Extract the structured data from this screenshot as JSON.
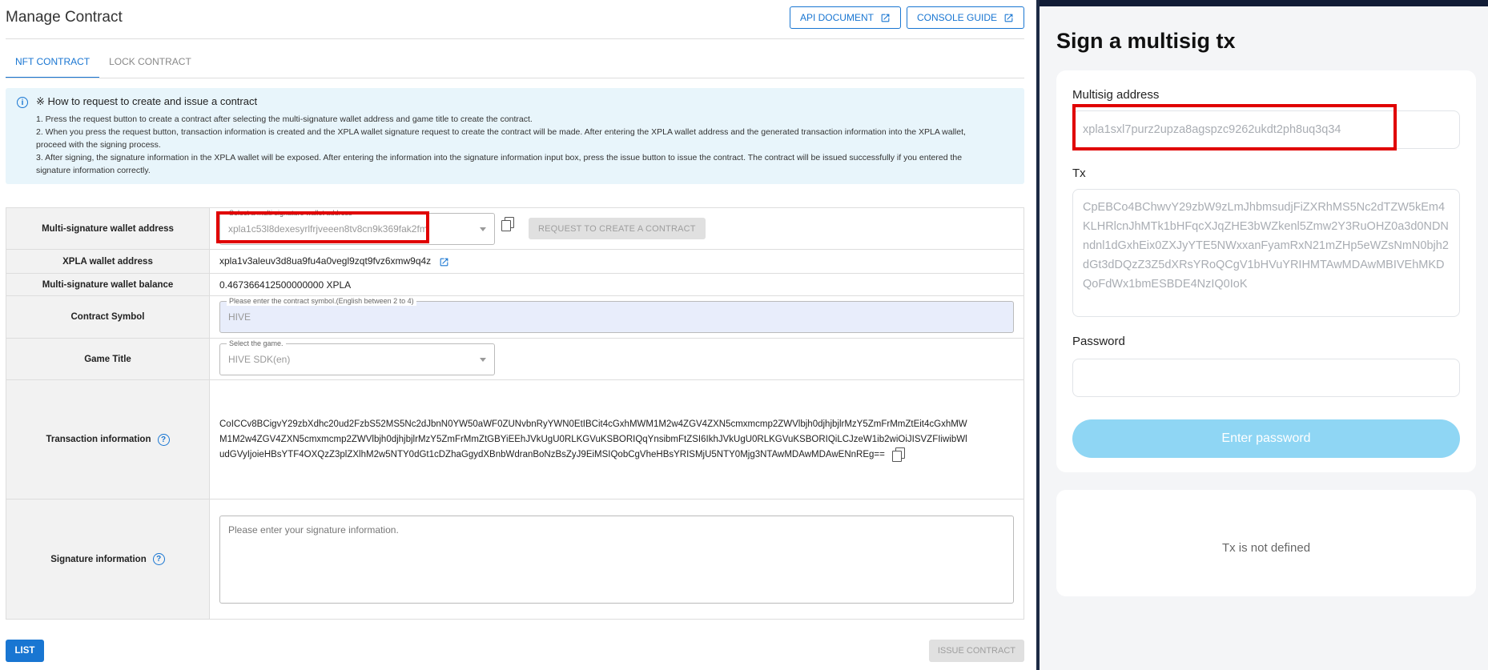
{
  "left": {
    "title": "Manage Contract",
    "buttons": {
      "api_document": "API DOCUMENT",
      "console_guide": "CONSOLE GUIDE"
    },
    "tabs": [
      {
        "label": "NFT CONTRACT",
        "active": true
      },
      {
        "label": "LOCK CONTRACT",
        "active": false
      }
    ],
    "info": {
      "title": "※ How to request to create and issue a contract",
      "lines": [
        "1. Press the request button to create a contract after selecting the multi-signature wallet address and game title to create the contract.",
        "2. When you press the request button, transaction information is created and the XPLA wallet signature request to create the contract will be made. After entering the XPLA wallet address and the generated transaction information into the XPLA wallet,",
        "proceed with the signing process.",
        "3. After signing, the signature information in the XPLA wallet will be exposed. After entering the information into the signature information input box, press the issue button to issue the contract. The contract will be issued successfully if you entered the",
        "signature information correctly."
      ]
    },
    "form": {
      "multisig_label": "Multi-signature wallet address",
      "multisig_legend": "Select a multi signature wallet address",
      "multisig_value": "xpla1c53l8dexesyrlfrjveeen8tv8cn9k369fak2fm",
      "request_button": "REQUEST TO CREATE A CONTRACT",
      "xpla_label": "XPLA wallet address",
      "xpla_value": "xpla1v3aleuv3d8ua9fu4a0vegl9zqt9fvz6xmw9q4z",
      "balance_label": "Multi-signature wallet balance",
      "balance_value": "0.467366412500000000 XPLA",
      "symbol_label": "Contract Symbol",
      "symbol_legend": "Please enter the contract symbol.(English between 2 to 4)",
      "symbol_value": "HIVE",
      "game_label": "Game Title",
      "game_legend": "Select the game.",
      "game_value": "HIVE SDK(en)",
      "tx_label": "Transaction information",
      "tx_lines": [
        "CoICCv8BCigvY29zbXdhc20ud2FzbS52MS5Nc2dJbnN0YW50aWF0ZUNvbnRyYWN0EtIBCit4cGxhMWM1M2w4ZGV4ZXN5cmxmcmp2ZWVlbjh0djhjbjlrMzY5ZmFrMmZtEit4cGxhMW",
        "M1M2w4ZGV4ZXN5cmxmcmp2ZWVlbjh0djhjbjlrMzY5ZmFrMmZtGBYiEEhJVkUgU0RLKGVuKSBORIQqYnsibmFtZSI6IkhJVkUgU0RLKGVuKSBORIQiLCJzeW1ib2wiOiJISVZFIiwibWl",
        "udGVyIjoieHBsYTF4OXQzZ3plZXlhM2w5NTY0dGt1cDZhaGgydXBnbWdranBoNzBsZyJ9EiMSIQobCgVheHBsYRISMjU5NTY0Mjg3NTAwMDAwMDAwENnREg=="
      ],
      "sig_label": "Signature information",
      "sig_placeholder": "Please enter your signature information."
    },
    "list_button": "LIST",
    "issue_button": "ISSUE CONTRACT"
  },
  "right": {
    "title": "Sign a multisig tx",
    "multisig_label": "Multisig address",
    "multisig_value": "xpla1sxl7purz2upza8agspzc9262ukdt2ph8uq3q34",
    "tx_label": "Tx",
    "tx_value": "CpEBCo4BChwvY29zbW9zLmJhbmsudjFiZXRhMS5Nc2dTZW5kEm4KLHRlcnJhMTk1bHFqcXJqZHE3bWZkenl5Zmw2Y3RuOHZ0a3d0NDNndnl1dGxhEix0ZXJyYTE5NWxxanFyamRxN21mZHp5eWZsNmN0bjh2dGt3dDQzZ3Z5dXRsYRoQCgV1bHVuYRIHMTAwMDAwMBIVEhMKDQoFdWx1bmESBDE4NzIQ0IoK",
    "password_label": "Password",
    "password_value": "",
    "enter_button": "Enter password",
    "status_message": "Tx is not defined"
  }
}
